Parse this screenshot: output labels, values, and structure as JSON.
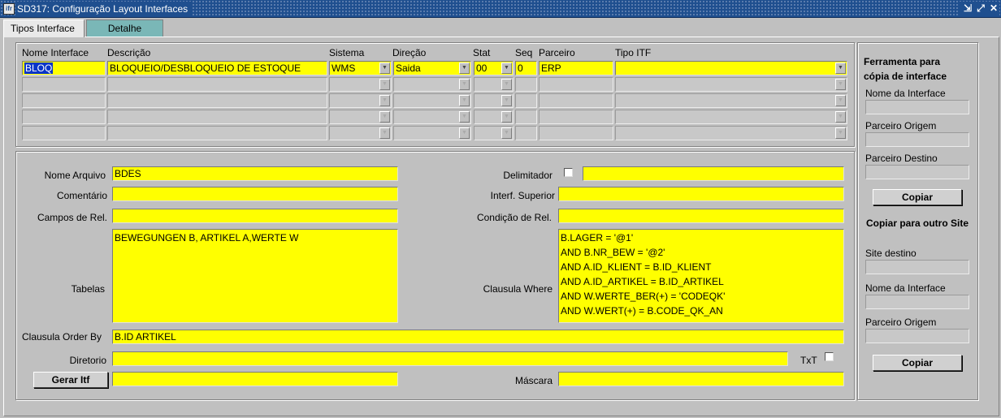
{
  "window": {
    "title": "SD317: Configuração Layout Interfaces",
    "app_icon_text": "ifr"
  },
  "tabs": [
    "Tipos Interface",
    "Detalhe"
  ],
  "grid": {
    "headers": {
      "nome": "Nome Interface",
      "descricao": "Descrição",
      "sistema": "Sistema",
      "direcao": "Direção",
      "stat": "Stat",
      "seq": "Seq",
      "parceiro": "Parceiro",
      "tipo_itf": "Tipo ITF"
    },
    "row1": {
      "nome": "BLOQ",
      "descricao": "BLOQUEIO/DESBLOQUEIO DE ESTOQUE",
      "sistema": "WMS",
      "direcao": "Saida",
      "stat": "00",
      "seq": "0",
      "parceiro": "ERP",
      "tipo_itf": ""
    }
  },
  "detail": {
    "nome_arquivo_label": "Nome Arquivo",
    "nome_arquivo": "BDES",
    "comentario_label": "Comentário",
    "comentario": "",
    "campos_rel_label": "Campos de Rel.",
    "campos_rel": "",
    "tabelas_label": "Tabelas",
    "tabelas": "BEWEGUNGEN B, ARTIKEL A,WERTE W",
    "delimitador_label": "Delimitador",
    "delimitador": "",
    "interf_superior_label": "Interf. Superior",
    "interf_superior": "",
    "condicao_rel_label": "Condição de Rel.",
    "condicao_rel": "",
    "clausula_where_label": "Clausula Where",
    "clausula_where": "B.LAGER = '@1'\nAND B.NR_BEW = '@2'\nAND A.ID_KLIENT = B.ID_KLIENT\nAND A.ID_ARTIKEL = B.ID_ARTIKEL\nAND W.WERTE_BER(+) = 'CODEQK'\nAND W.WERT(+) = B.CODE_QK_AN",
    "order_by_label": "Clausula Order By",
    "order_by": "B.ID  ARTIKEL",
    "diretorio_label": "Diretorio",
    "diretorio": "",
    "txt_label": "TxT",
    "gerar_itf_label": "Gerar Itf",
    "gerar_itf_value": "",
    "mascara_label": "Máscara",
    "mascara": ""
  },
  "sidebar": {
    "copy_tool_title": "Ferramenta para cópia de interface",
    "nome_interface_label": "Nome da Interface",
    "parceiro_origem_label": "Parceiro Origem",
    "parceiro_destino_label": "Parceiro Destino",
    "copiar_label": "Copiar",
    "copy_site_title": "Copiar para outro Site",
    "site_destino_label": "Site destino",
    "nome_interface2_label": "Nome da Interface",
    "parceiro_origem2_label": "Parceiro Origem",
    "copiar2_label": "Copiar"
  },
  "colors": {
    "field_active": "#ffff00",
    "title_bar": "#1f4f8f",
    "inactive_tab": "#7ab7b7"
  }
}
